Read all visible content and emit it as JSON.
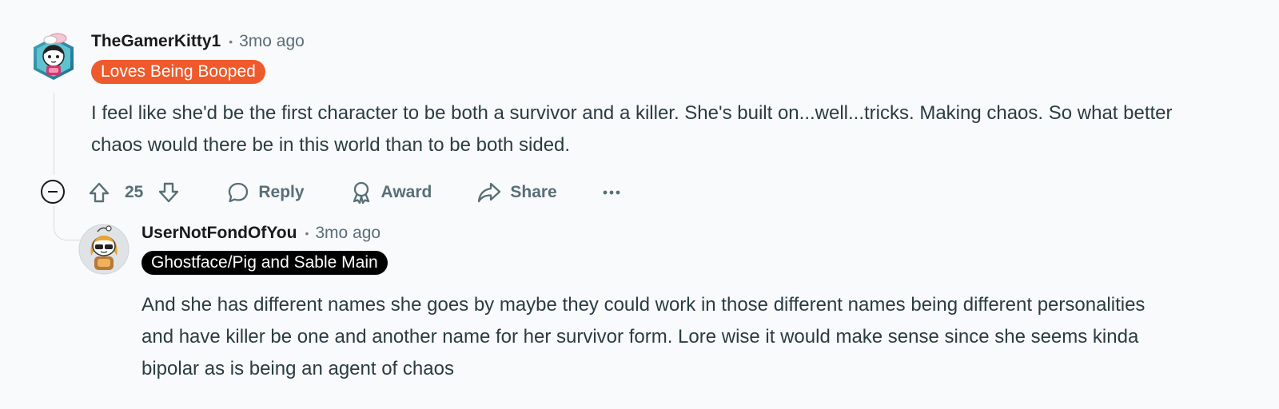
{
  "comments": [
    {
      "username": "TheGamerKitty1",
      "separator": "•",
      "timestamp": "3mo ago",
      "flair": "Loves Being Booped",
      "flair_color": "#ee5a2b",
      "body": "I feel like she'd be the first character to be both a survivor and a killer. She's built on...well...tricks. Making chaos. So what better chaos would there be in this world than to be both sided.",
      "score": "25",
      "actions": {
        "reply": "Reply",
        "award": "Award",
        "share": "Share"
      }
    },
    {
      "username": "UserNotFondOfYou",
      "separator": "•",
      "timestamp": "3mo ago",
      "flair": "Ghostface/Pig and Sable Main",
      "flair_color": "#000000",
      "body": "And she has different names she goes by maybe they could work in those different names being different personalities and have killer be one and another name for her survivor form. Lore wise it would make sense since she seems kinda bipolar as is being an agent of chaos"
    }
  ],
  "colors": {
    "background": "#f9fafc",
    "meta_text": "#576f76",
    "body_text": "#2a3c42"
  },
  "icons": [
    "upvote-icon",
    "downvote-icon",
    "comment-icon",
    "award-icon",
    "share-icon",
    "more-icon",
    "collapse-icon"
  ]
}
